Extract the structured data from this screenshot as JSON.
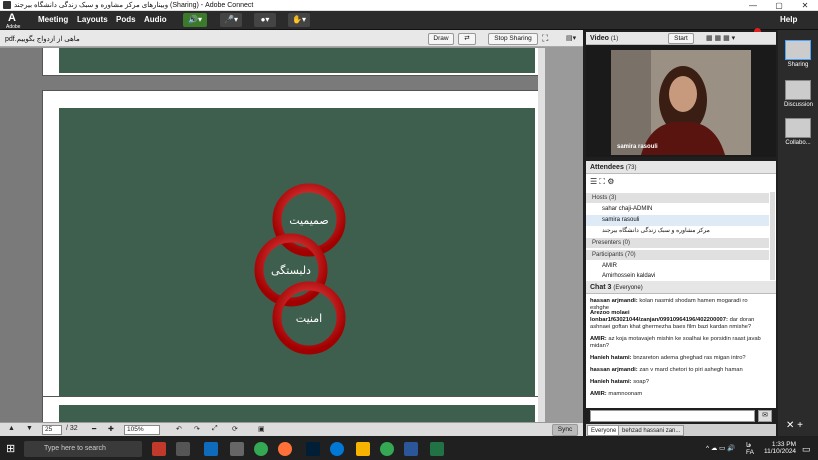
{
  "window": {
    "title": "وبینارهای مرکز مشاوره و سبک زندگی دانشگاه بیرجند (Sharing) - Adobe Connect",
    "help": "Help",
    "min": "—",
    "max": "▢",
    "close": "✕"
  },
  "menu": {
    "logo_text": "Adobe",
    "items": [
      "Meeting",
      "Layouts",
      "Pods",
      "Audio"
    ]
  },
  "share": {
    "filename": "pdf.ماهی از ازدواج بگوییم",
    "draw": "Draw",
    "stop": "Stop Sharing",
    "sync": "Sync"
  },
  "doc": {
    "page": "25",
    "total": "/ 32",
    "zoom": "105%",
    "words": [
      "صمیمیت",
      "دلبستگی",
      "امنیت"
    ]
  },
  "video": {
    "title": "Video",
    "count": "(1)",
    "start": "Start",
    "name": "samira rasouli"
  },
  "attendees": {
    "title": "Attendees",
    "count": "(73)",
    "hosts": "Hosts (3)",
    "hostlist": [
      "sahar chaji-ADMIN",
      "samira rasouli",
      "مرکز مشاوره و سبک زندگی دانشگاه بیرجند"
    ],
    "presenters": "Presenters (0)",
    "participants": "Participants (70)",
    "partlist": [
      "AMIR",
      "Amirhossein kaldavi"
    ]
  },
  "chat": {
    "title": "Chat 3",
    "scope": "(Everyone)",
    "messages": [
      {
        "who": "hassan arjmandi:",
        "text": "kolan nasmid shodam hamen mogaradi ro eshghe"
      },
      {
        "who": "Arezoo molaei lonbar1f63021044/zanjan/09910964196/402200007:",
        "text": "dar doran ashnaei goftan khat ghermezha baes film bazi kardan nmishe?"
      },
      {
        "who": "AMIR:",
        "text": "az koja motavajeh mishin ke soalhai ke porsidin raast javab midan?"
      },
      {
        "who": "Hanieh hatami:",
        "text": "bnzareton adema gheghad ras migan intro?"
      },
      {
        "who": "hassan arjmandi:",
        "text": "zan v mard chetori to piri ashegh haman"
      },
      {
        "who": "Hanieh hatami:",
        "text": "soap?"
      },
      {
        "who": "AMIR:",
        "text": "mamnoonam"
      }
    ],
    "tabs": [
      "Everyone",
      "behzad hassani zan..."
    ]
  },
  "right": {
    "items": [
      "Sharing",
      "Discussion",
      "Collabo..."
    ]
  },
  "taskbar": {
    "search": "Type here to search",
    "lang": "FA",
    "time": "1:33 PM",
    "date": "11/10/2024",
    "lang2": "فا"
  }
}
